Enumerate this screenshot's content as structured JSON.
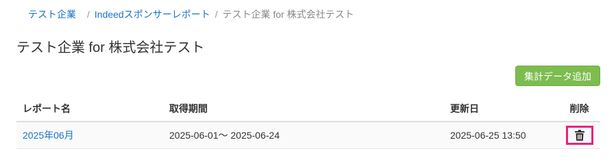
{
  "breadcrumb": {
    "company": "テスト企業",
    "separator": "/",
    "section": "Indeedスポンサーレポート",
    "current": "テスト企業 for 株式会社テスト"
  },
  "page": {
    "title": "テスト企業 for 株式会社テスト"
  },
  "toolbar": {
    "add_label": "集計データ追加"
  },
  "table": {
    "headers": {
      "name": "レポート名",
      "period": "取得期間",
      "updated": "更新日",
      "delete": "削除"
    },
    "rows": [
      {
        "name": "2025年06月",
        "period": "2025-06-01～ 2025-06-24",
        "updated": "2025-06-25 13:50",
        "delete_icon": "trash-icon"
      }
    ]
  },
  "colors": {
    "link": "#1a73c8",
    "accent_button": "#7dbc4f",
    "highlight": "#e8247a"
  }
}
